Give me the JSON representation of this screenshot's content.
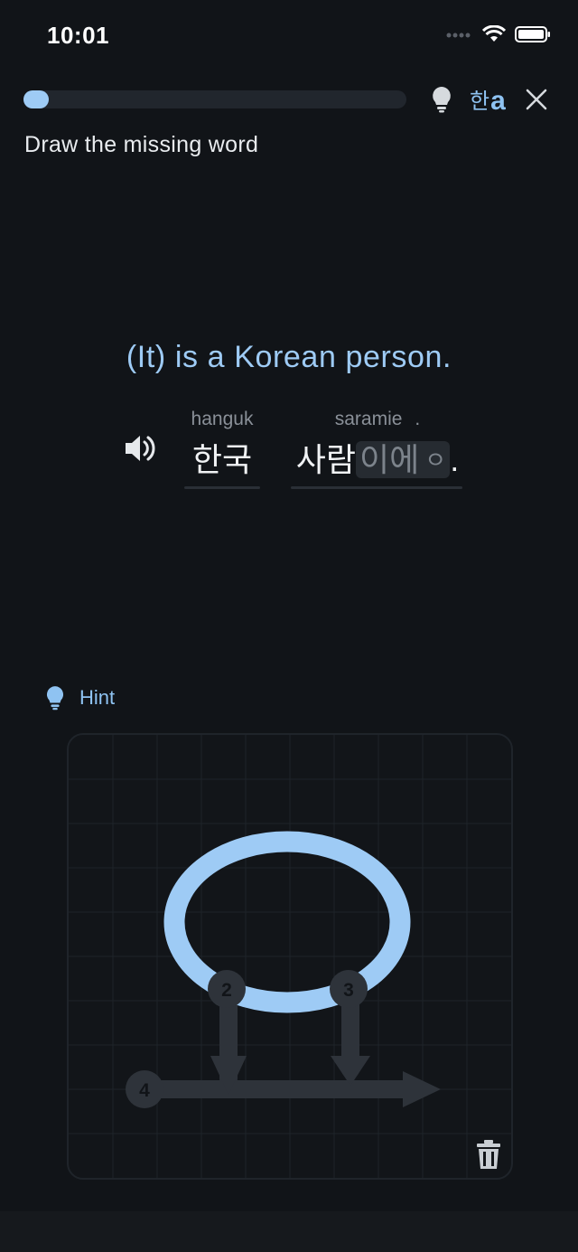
{
  "status_bar": {
    "time": "10:01"
  },
  "progress": {
    "value": 0.065
  },
  "top_bar": {
    "lang_toggle_small": "한",
    "lang_toggle_big": "a"
  },
  "instruction": "Draw the missing word",
  "translation": "(It) is a Korean person.",
  "sentence": {
    "words": [
      {
        "romaji": "hanguk",
        "hangul": "한국"
      },
      {
        "romaji": "saramie",
        "romaji_suffix": ".",
        "hangul_known": "사람",
        "hangul_missing": "이에",
        "missing_glyph": "ㅇ",
        "punct": "."
      }
    ]
  },
  "hint": {
    "label": "Hint"
  },
  "canvas": {
    "stroke_numbers": [
      "2",
      "3",
      "4"
    ]
  },
  "colors": {
    "accent": "#9ecbf5",
    "background": "#111418",
    "guide": "#2e333a"
  }
}
